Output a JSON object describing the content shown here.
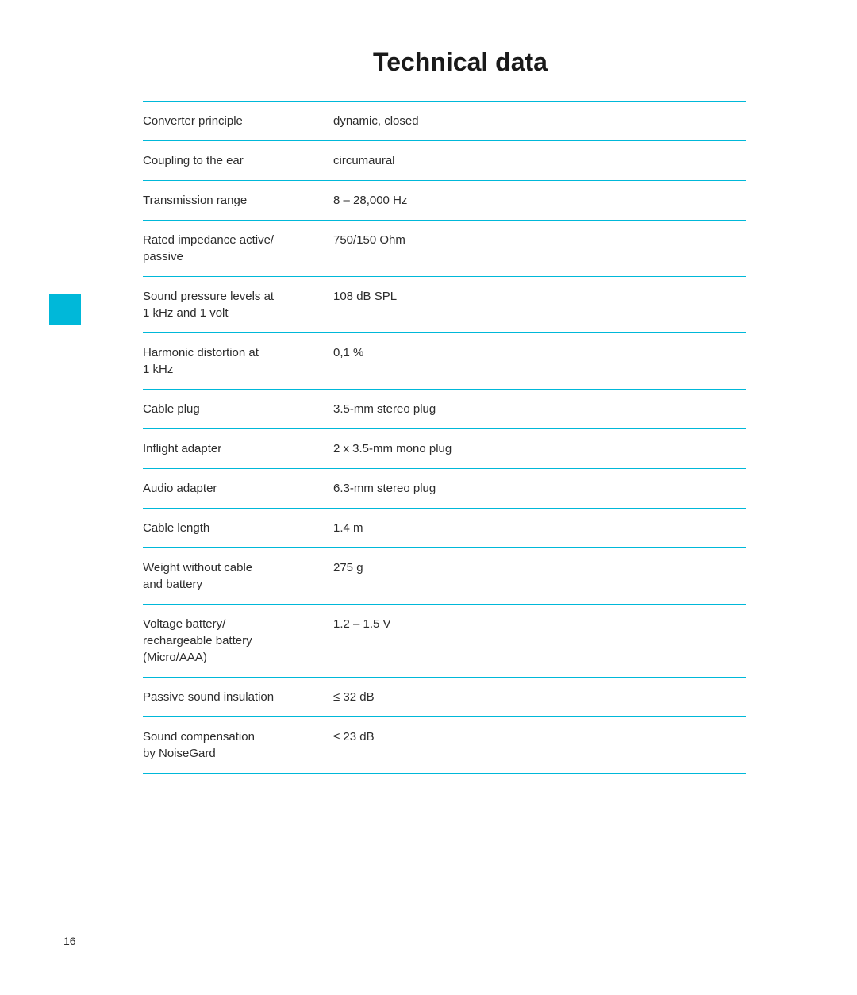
{
  "page": {
    "title": "Technical data",
    "page_number": "16"
  },
  "table": {
    "rows": [
      {
        "label": "Converter principle",
        "value": "dynamic, closed"
      },
      {
        "label": "Coupling to the ear",
        "value": "circumaural"
      },
      {
        "label": "Transmission range",
        "value": "8 – 28,000 Hz"
      },
      {
        "label": "Rated impedance active/\npassive",
        "value": "750/150 Ohm"
      },
      {
        "label": "Sound pressure levels at\n1 kHz and 1 volt",
        "value": "108 dB SPL"
      },
      {
        "label": "Harmonic distortion at\n1 kHz",
        "value": "0,1 %"
      },
      {
        "label": "Cable plug",
        "value": "3.5-mm stereo plug"
      },
      {
        "label": "Inflight adapter",
        "value": "2 x 3.5-mm mono plug"
      },
      {
        "label": "Audio adapter",
        "value": "6.3-mm stereo plug"
      },
      {
        "label": "Cable length",
        "value": "1.4 m"
      },
      {
        "label": "Weight without cable\nand battery",
        "value": "275 g"
      },
      {
        "label": "Voltage battery/\nrechargeable battery\n(Micro/AAA)",
        "value": "1.2 – 1.5 V"
      },
      {
        "label": "Passive sound insulation",
        "value": "≤ 32 dB"
      },
      {
        "label": "Sound compensation\nby NoiseGard",
        "value": "≤ 23 dB"
      }
    ]
  },
  "colors": {
    "accent": "#00b8d9",
    "text": "#2c2c2c",
    "blue_square": "#00b8d9"
  }
}
